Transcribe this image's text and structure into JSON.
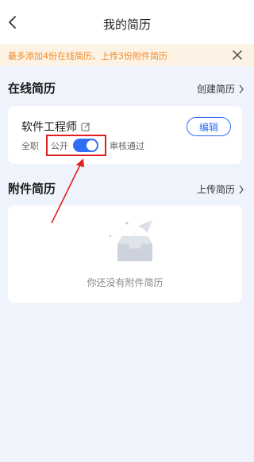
{
  "nav": {
    "title": "我的简历",
    "back_icon": "chevron-left-icon"
  },
  "notice": {
    "text": "最多添加4份在线简历、上传3份附件简历",
    "close_icon": "close-icon",
    "color": "#f08a2a"
  },
  "online_section": {
    "title": "在线简历",
    "action_label": "创建简历"
  },
  "resume_card": {
    "name": "软件工程师",
    "edit_icon": "edit-icon",
    "edit_label": "编辑",
    "job_type": "全职",
    "visibility_label": "公开",
    "visibility_on": true,
    "review_status": "审核通过"
  },
  "attachment_section": {
    "title": "附件简历",
    "action_label": "上传简历",
    "empty_text": "你还没有附件简历",
    "empty_icon": "empty-inbox-icon"
  },
  "colors": {
    "accent": "#2f6df5",
    "annotation": "#e02020",
    "background": "#eff3fb"
  }
}
